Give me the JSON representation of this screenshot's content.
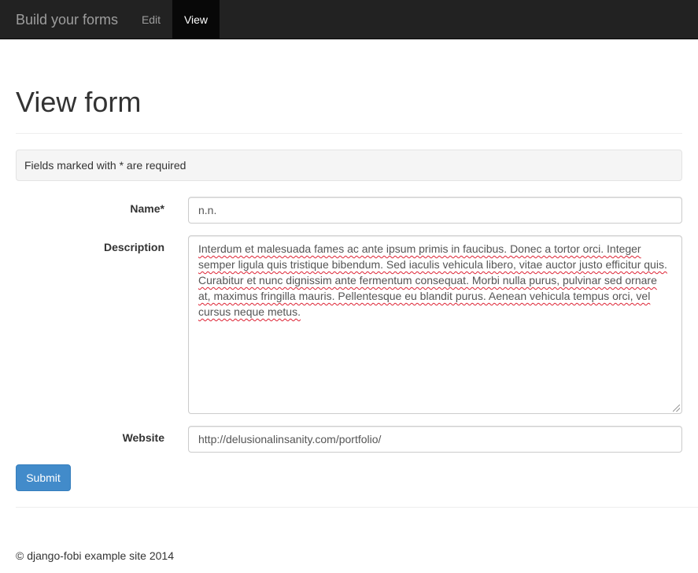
{
  "navbar": {
    "brand": "Build your forms",
    "items": [
      {
        "label": "Edit",
        "active": false
      },
      {
        "label": "View",
        "active": true
      }
    ],
    "background": "#222222",
    "active_background": "#080808"
  },
  "page": {
    "title": "View form",
    "notice": "Fields marked with * are required"
  },
  "form": {
    "name": {
      "label": "Name*",
      "value": "n.n."
    },
    "description": {
      "label": "Description",
      "value": "Interdum et malesuada fames ac ante ipsum primis in faucibus. Donec a tortor orci. Integer semper ligula quis tristique bibendum. Sed iaculis vehicula libero, vitae auctor justo efficitur quis. Curabitur et nunc dignissim ante fermentum consequat. Morbi nulla purus, pulvinar sed ornare at, maximus fringilla mauris. Pellentesque eu blandit purus. Aenean vehicula tempus orci, vel cursus neque metus."
    },
    "website": {
      "label": "Website",
      "value": "http://delusionalinsanity.com/portfolio/"
    },
    "submit_label": "Submit",
    "submit_color": "#428bca"
  },
  "footer": {
    "text": "© django-fobi example site 2014"
  }
}
